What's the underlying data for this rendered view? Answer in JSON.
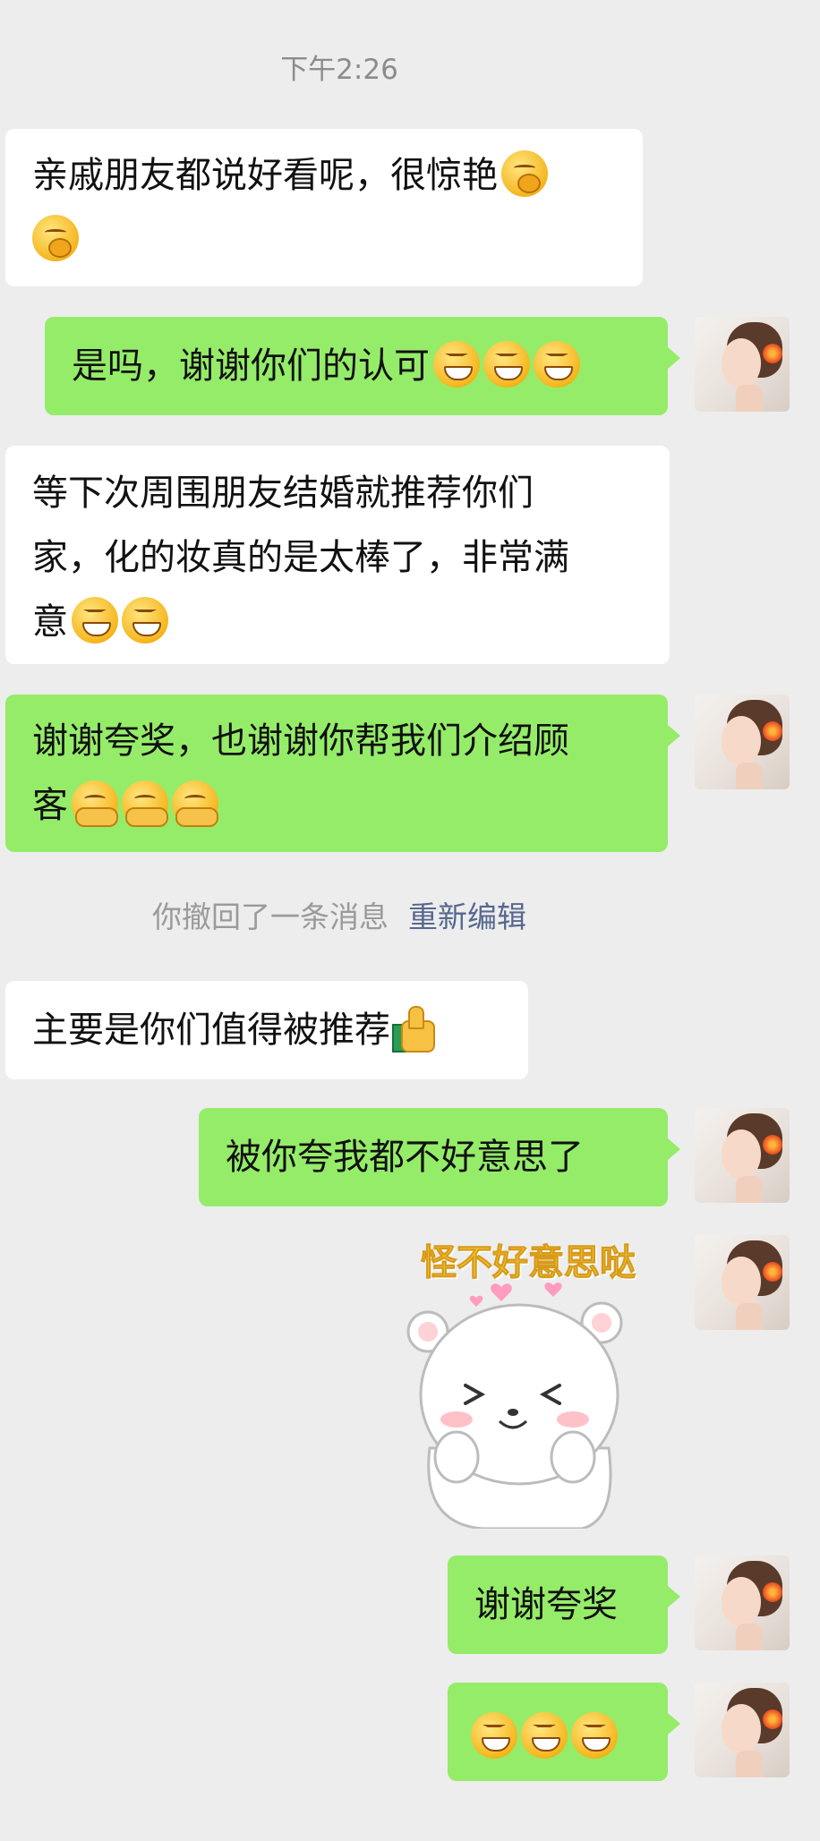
{
  "timestamp": "下午2:26",
  "messages": [
    {
      "side": "in",
      "text": "亲戚朋友都说好看呢，很惊艳",
      "emojis": [
        "thinking-face",
        "thinking-face"
      ]
    },
    {
      "side": "out",
      "text": "是吗，谢谢你们的认可",
      "emojis": [
        "grinning-squint",
        "grinning-squint",
        "grinning-squint"
      ]
    },
    {
      "side": "in",
      "text_lines": [
        "等下次周围朋友结婚就推荐你们",
        "家，化的妆真的是太棒了，非常满",
        "意"
      ],
      "emojis": [
        "grinning-squint",
        "grinning-squint"
      ]
    },
    {
      "side": "out",
      "text_lines": [
        "谢谢夸奖，也谢谢你帮我们介绍顾",
        "客"
      ],
      "emojis": [
        "hugging-face",
        "hugging-face",
        "hugging-face"
      ]
    },
    {
      "side": "out",
      "text": "被你夸我都不好意思了"
    },
    {
      "side": "out",
      "text": "谢谢夸奖"
    },
    {
      "side": "out",
      "emojis": [
        "grinning-squint",
        "grinning-squint",
        "grinning-squint"
      ]
    }
  ],
  "recall_notice": {
    "text": "你撤回了一条消息",
    "action": "重新编辑",
    "action_color": "#56688f"
  },
  "msg5": {
    "text": "主要是你们值得被推荐",
    "emoji": "thumbs-up"
  },
  "sticker": {
    "caption": "怪不好意思哒",
    "icon": "shy-white-bear-sticker"
  },
  "colors": {
    "background": "#ededed",
    "incoming_bubble": "#ffffff",
    "outgoing_bubble": "#95ec69"
  }
}
